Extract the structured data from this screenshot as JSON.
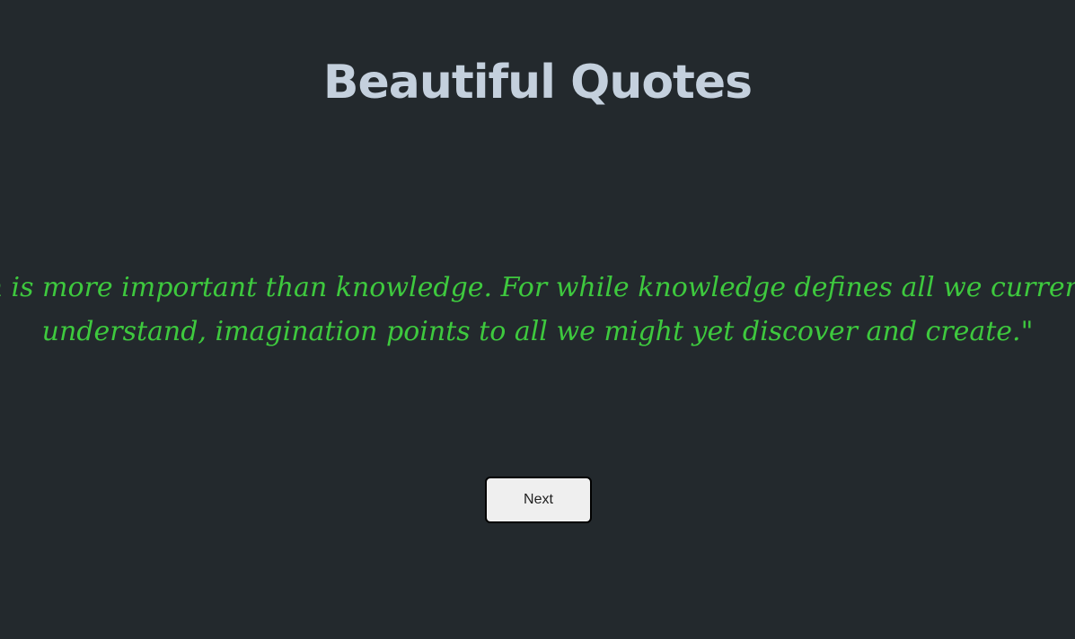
{
  "page": {
    "title": "Beautiful Quotes",
    "quote": {
      "line1": "ion is more important than knowledge. For while knowledge defines all we currently",
      "line2": "understand, imagination points to all we might yet discover and create.\""
    },
    "next_label": "Next"
  },
  "colors": {
    "background": "#23292d",
    "title": "#c4d0dd",
    "quote": "#3ec93e",
    "button_bg": "#efefef"
  }
}
